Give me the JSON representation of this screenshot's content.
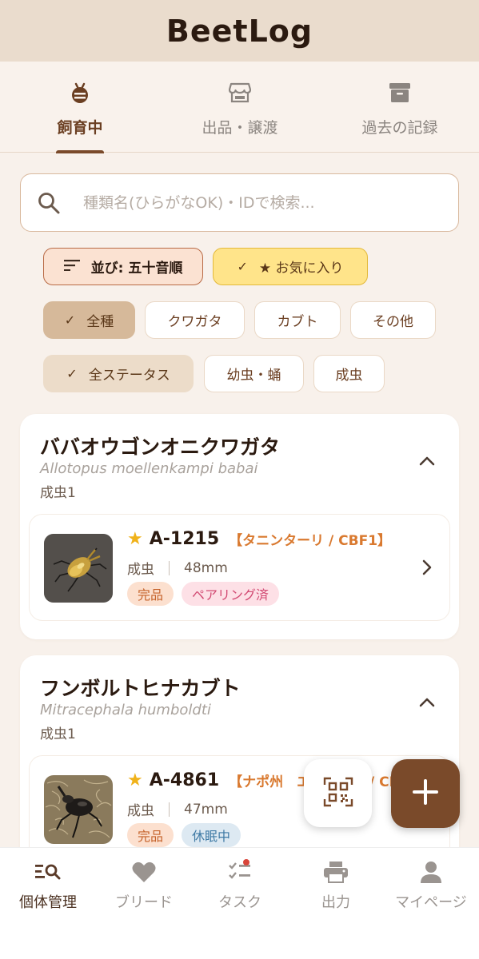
{
  "app": {
    "title": "BeetLog"
  },
  "tabs": [
    {
      "label": "飼育中",
      "icon": "bug-icon",
      "active": true
    },
    {
      "label": "出品・譲渡",
      "icon": "store-icon",
      "active": false
    },
    {
      "label": "過去の記録",
      "icon": "archive-icon",
      "active": false
    }
  ],
  "search": {
    "placeholder": "種類名(ひらがなOK)・IDで検索...",
    "value": ""
  },
  "filters": {
    "sort": {
      "label": "並び: 五十音順"
    },
    "favorite": {
      "label": "★ お気に入り",
      "checked": true
    },
    "type_chips": [
      {
        "label": "全種",
        "selected": true
      },
      {
        "label": "クワガタ",
        "selected": false
      },
      {
        "label": "カブト",
        "selected": false
      },
      {
        "label": "その他",
        "selected": false
      }
    ],
    "status_chips": [
      {
        "label": "全ステータス",
        "selected": true
      },
      {
        "label": "幼虫・蛹",
        "selected": false
      },
      {
        "label": "成虫",
        "selected": false
      }
    ]
  },
  "groups": [
    {
      "name": "ババオウゴンオニクワガタ",
      "scientific": "Allotopus moellenkampi babai",
      "count": "成虫1",
      "items": [
        {
          "star": "★",
          "code": "A-1215",
          "origin": "【タニンターリ / CBF1】",
          "stage": "成虫",
          "size": "48mm",
          "badges": [
            "完品",
            "ペアリング済"
          ]
        }
      ]
    },
    {
      "name": "フンボルトヒナカブト",
      "scientific": "Mitracephala humboldti",
      "count": "成虫1",
      "items": [
        {
          "star": "★",
          "code": "A-4861",
          "origin": "【ナポ州　エクアドル / CBF1】",
          "stage": "成虫",
          "size": "47mm",
          "badges": [
            "完品",
            "休眠中"
          ]
        }
      ]
    }
  ],
  "bottom_nav": [
    {
      "label": "個体管理",
      "icon": "list-search-icon",
      "active": true
    },
    {
      "label": "ブリード",
      "icon": "heart-icon",
      "active": false
    },
    {
      "label": "タスク",
      "icon": "checklist-icon",
      "active": false
    },
    {
      "label": "出力",
      "icon": "printer-icon",
      "active": false
    },
    {
      "label": "マイページ",
      "icon": "person-icon",
      "active": false
    }
  ],
  "colors": {
    "brand": "#7a4a2a",
    "accent_orange": "#d9792f",
    "star": "#f0b21a",
    "background": "#f8f1eb"
  }
}
